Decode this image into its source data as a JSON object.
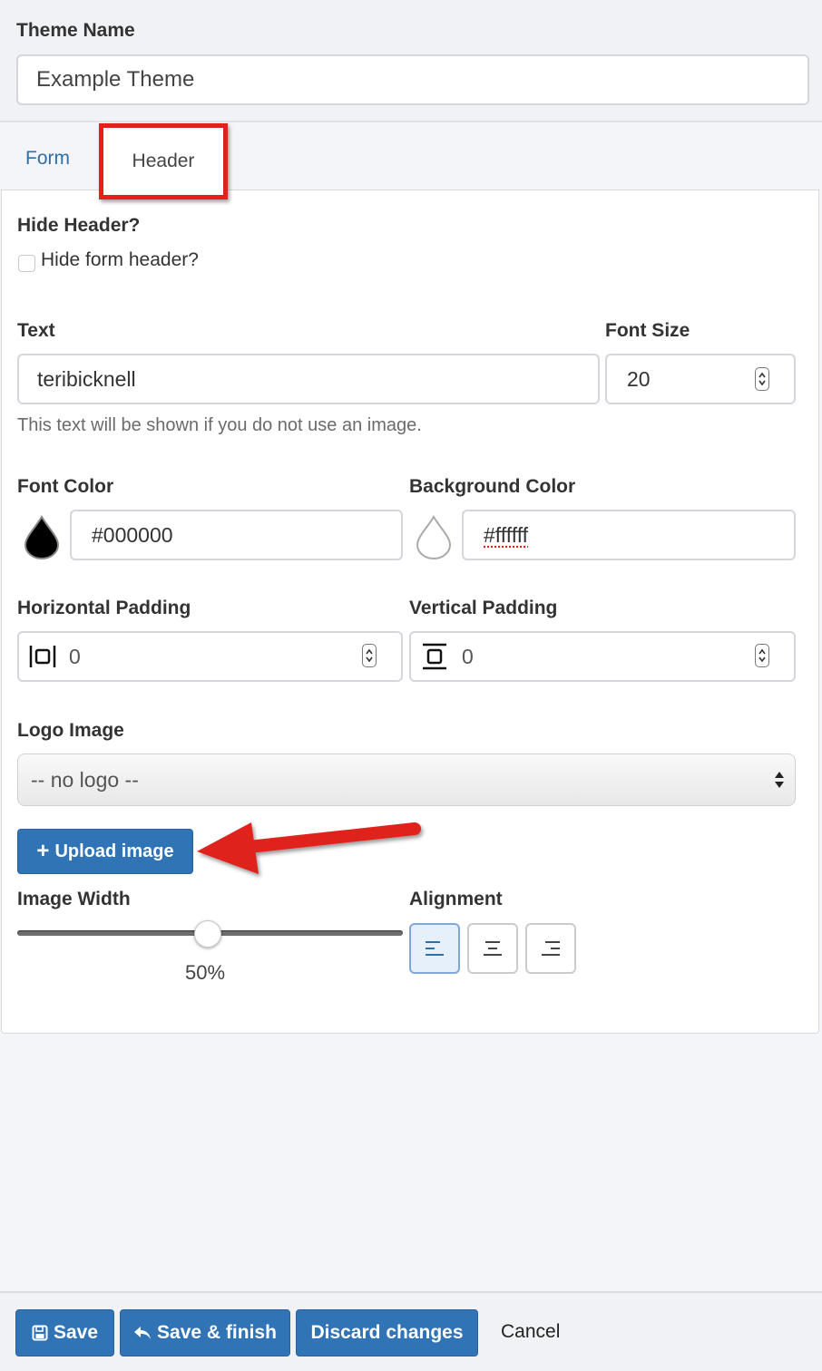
{
  "theme_name": {
    "label": "Theme Name",
    "value": "Example Theme"
  },
  "tabs": [
    {
      "label": "Form"
    },
    {
      "label": "Header"
    }
  ],
  "hide_header": {
    "label": "Hide Header?",
    "checkbox_label": "Hide form header?",
    "checked": false
  },
  "text": {
    "label": "Text",
    "value": "teribicknell",
    "help": "This text will be shown if you do not use an image."
  },
  "font_size": {
    "label": "Font Size",
    "value": "20"
  },
  "font_color": {
    "label": "Font Color",
    "value": "#000000"
  },
  "background_color": {
    "label": "Background Color",
    "value": "#ffffff"
  },
  "horizontal_padding": {
    "label": "Horizontal Padding",
    "value": "0"
  },
  "vertical_padding": {
    "label": "Vertical Padding",
    "value": "0"
  },
  "logo_image": {
    "label": "Logo Image",
    "selected": "-- no logo --"
  },
  "upload_button": {
    "label": "Upload image"
  },
  "image_width": {
    "label": "Image Width",
    "value_text": "50%",
    "fraction": 0.5
  },
  "alignment": {
    "label": "Alignment",
    "options": [
      "left",
      "center",
      "right"
    ],
    "selected": "left"
  },
  "footer": {
    "save": "Save",
    "save_finish": "Save & finish",
    "discard": "Discard changes",
    "cancel": "Cancel"
  },
  "colors": {
    "accent": "#3074b5",
    "highlight": "#e0221b"
  }
}
